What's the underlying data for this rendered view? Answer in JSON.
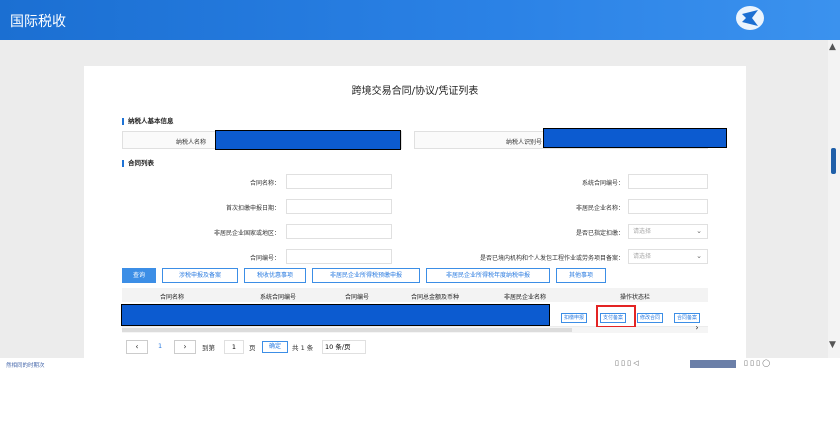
{
  "app": {
    "title": "国际税收"
  },
  "page": {
    "title": "跨境交易合同/协议/凭证列表"
  },
  "taxpayer": {
    "section_title": "纳税人基本信息",
    "name_label": "纳税人名称",
    "id_label": "纳税人识别号"
  },
  "contract_list": {
    "section_title": "合同列表",
    "fields": {
      "contract_name": "合同名称：",
      "system_no": "系统合同编号：",
      "first_withhold_date": "首次扣缴申报日期：",
      "nonresident_name": "非居民企业名称：",
      "nonresident_region": "非居民企业国家或地区：",
      "designated_withhold": "是否已指定扣缴：",
      "contract_no": "合同编号：",
      "labor_filing": "是否已境内机构和个人发包工程作业或劳务项目备案："
    },
    "select_placeholder": "请选择"
  },
  "buttons": {
    "query": "查询",
    "tax_filing": "涉税申报及备案",
    "treaty": "税收优惠事项",
    "prepay": "非居民企业所得税预缴申报",
    "annual": "非居民企业所得税年度纳税申报",
    "other": "其他事项"
  },
  "table": {
    "headers": [
      "合同名称",
      "系统合同编号",
      "合同编号",
      "合同总金额及币种",
      "非居民企业名称",
      "操作状态栏"
    ],
    "row_actions": [
      "扣缴申报",
      "支付备案",
      "修改合同",
      "合同备案"
    ]
  },
  "pager": {
    "current": "1",
    "goto_label": "到第",
    "page_value": "1",
    "page_unit": "页",
    "confirm": "确定",
    "total": "共 1 条",
    "page_size": "10 条/页"
  },
  "status": {
    "left_text": "然相同的时期次"
  }
}
